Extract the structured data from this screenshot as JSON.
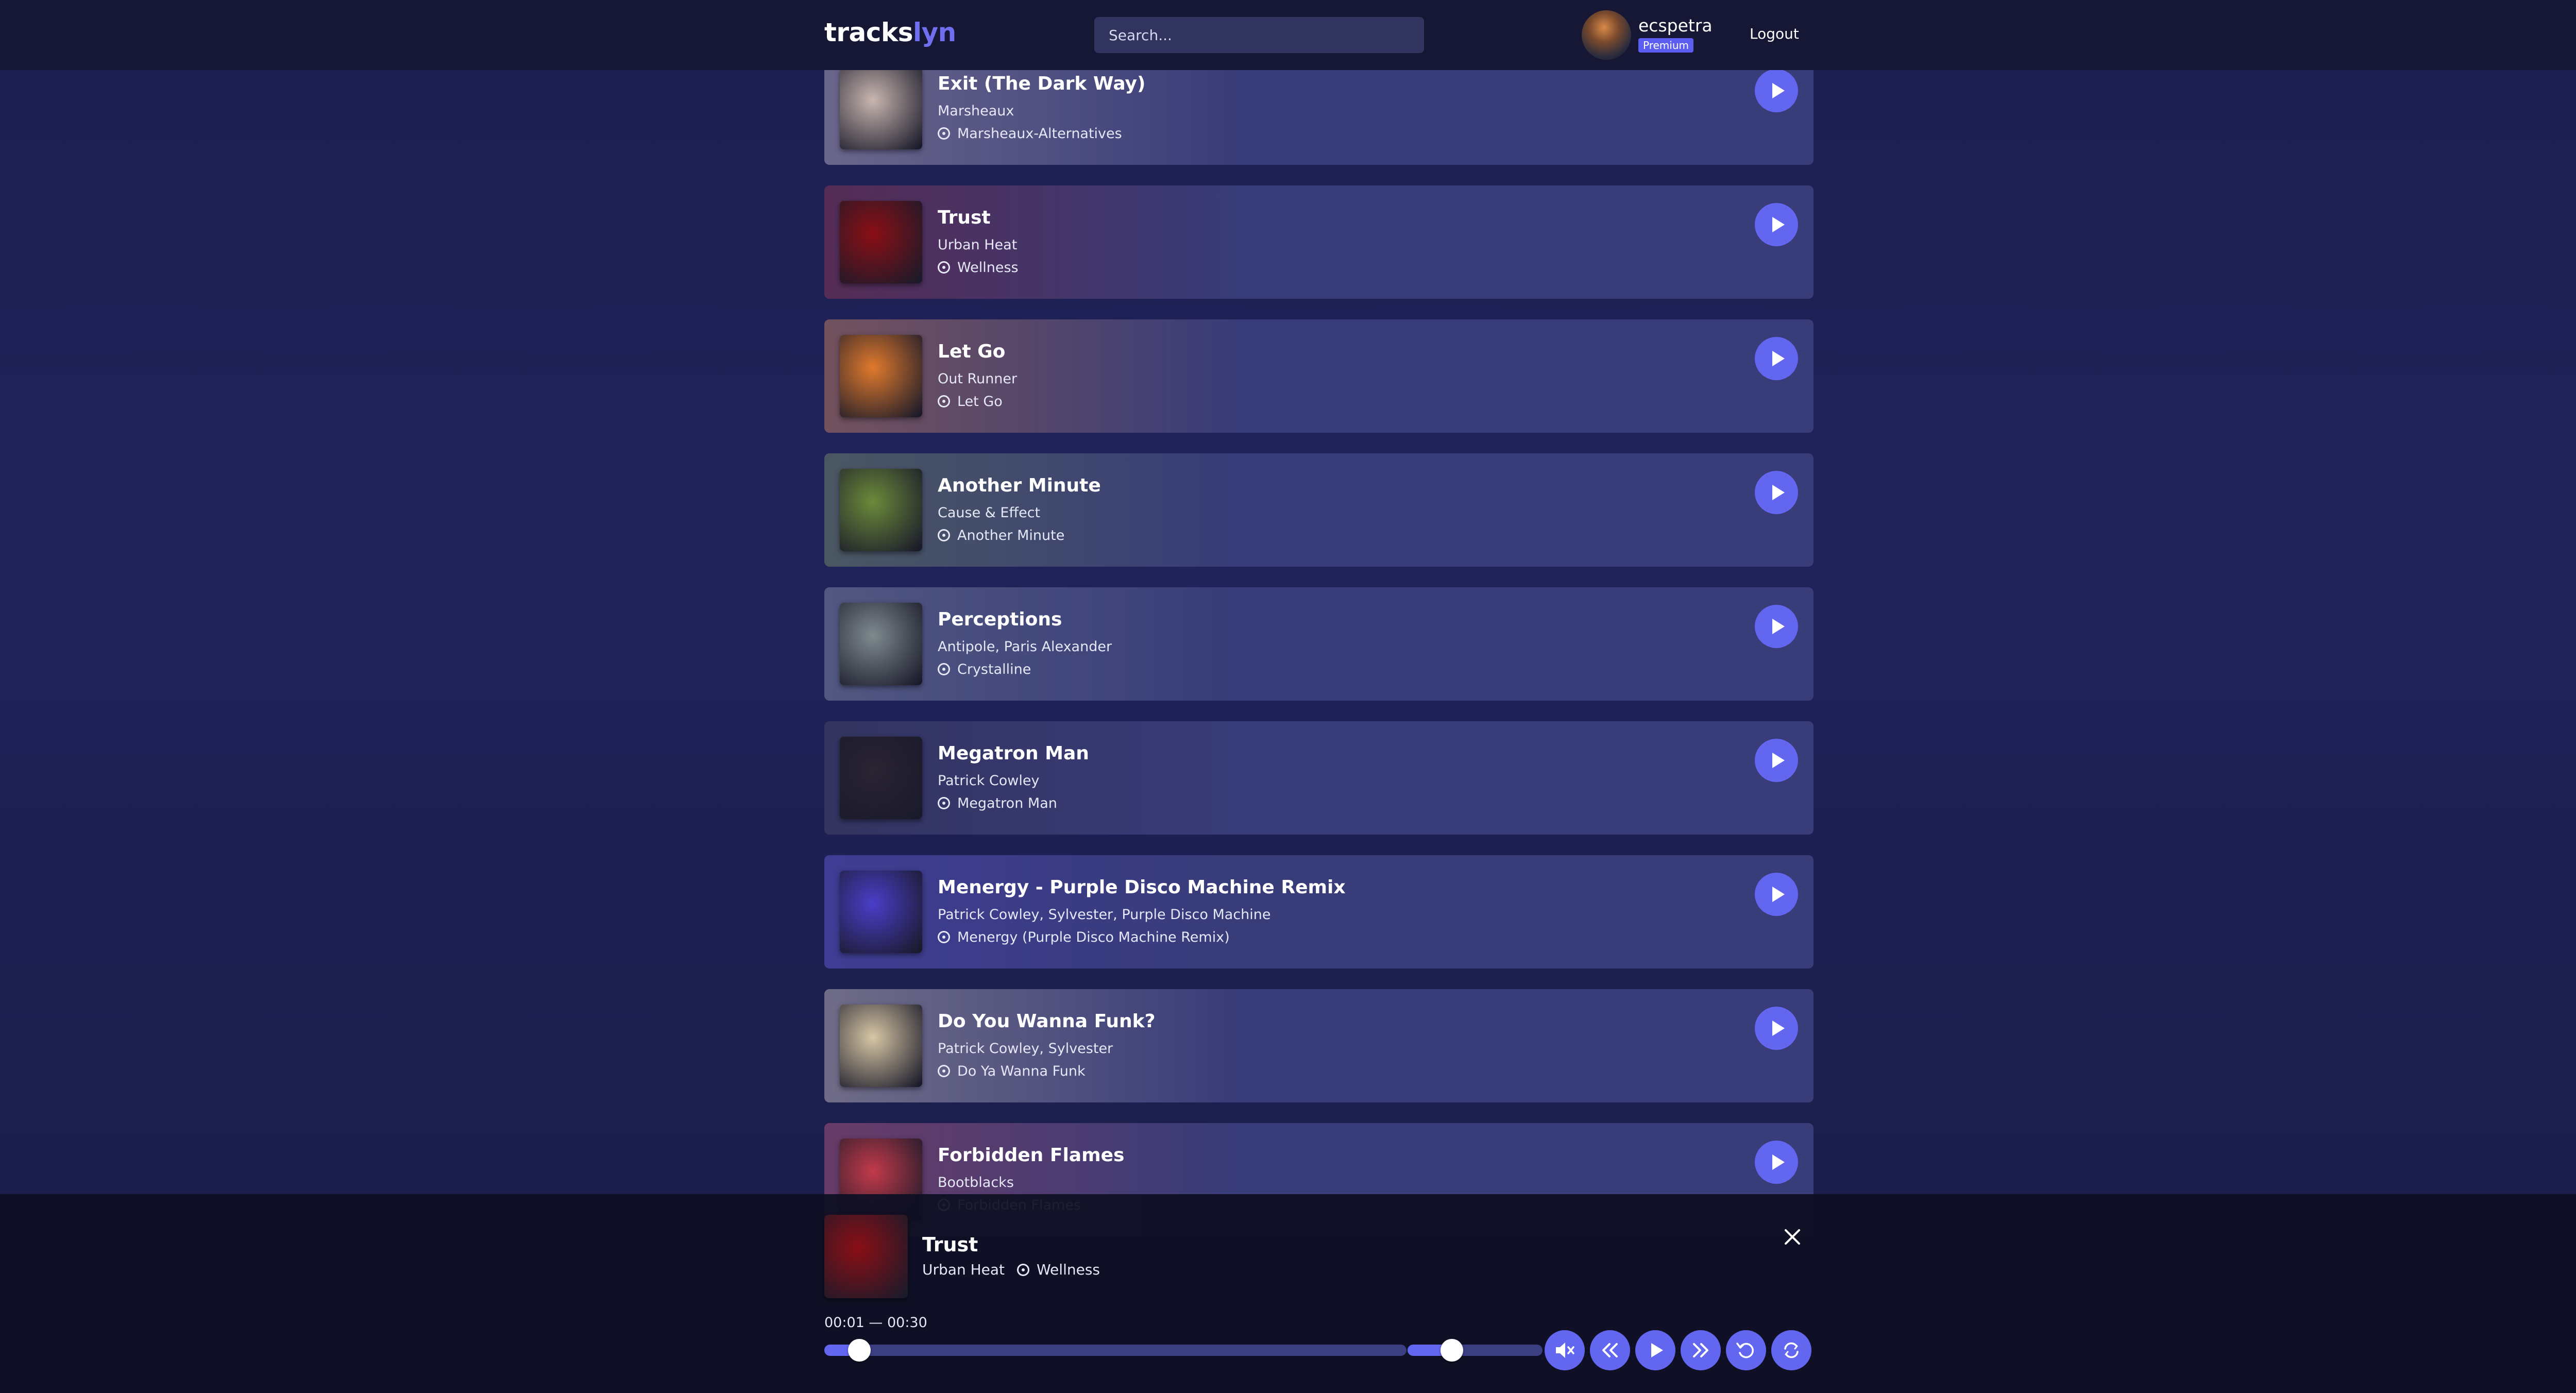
{
  "header": {
    "logo_part1": "tracks",
    "logo_part2": "lyn",
    "search_placeholder": "Search...",
    "user_name": "ecspetra",
    "badge": "Premium",
    "logout_label": "Logout"
  },
  "tracks": [
    {
      "title": "Exit (The Dark Way)",
      "artists": "Marsheaux",
      "album": "Marsheaux-Alternatives",
      "accent": "#c9b6b0"
    },
    {
      "title": "Trust",
      "artists": "Urban Heat",
      "album": "Wellness",
      "accent": "#8a0f15"
    },
    {
      "title": "Let Go",
      "artists": "Out Runner",
      "album": "Let Go",
      "accent": "#e07a2c"
    },
    {
      "title": "Another Minute",
      "artists": "Cause & Effect",
      "album": "Another Minute",
      "accent": "#6b8a3a"
    },
    {
      "title": "Perceptions",
      "artists": "Antipole, Paris Alexander",
      "album": "Crystalline",
      "accent": "#7f8a8f"
    },
    {
      "title": "Megatron Man",
      "artists": "Patrick Cowley",
      "album": "Megatron Man",
      "accent": "#2a2433"
    },
    {
      "title": "Menergy - Purple Disco Machine Remix",
      "artists": "Patrick Cowley, Sylvester, Purple Disco Machine",
      "album": "Menergy (Purple Disco Machine Remix)",
      "accent": "#4a3ec8"
    },
    {
      "title": "Do You Wanna Funk?",
      "artists": "Patrick Cowley, Sylvester",
      "album": "Do Ya Wanna Funk",
      "accent": "#d8c7a5"
    },
    {
      "title": "Forbidden Flames",
      "artists": "Bootblacks",
      "album": "Forbidden Flames",
      "accent": "#c23a4a"
    }
  ],
  "player": {
    "title": "Trust",
    "artist": "Urban Heat",
    "album": "Wellness",
    "time": "00:01 — 00:30",
    "progress": 0.033,
    "volume": 0.33,
    "cover_accent": "#8a0f15"
  },
  "colors": {
    "accent": "#6367f0",
    "card": "#383c78",
    "header": "#161735"
  },
  "icons": {
    "play": "play-icon",
    "mute": "volume-mute-icon",
    "prev": "skip-back-icon",
    "next": "skip-forward-icon",
    "replay": "replay-icon",
    "repeat": "repeat-icon",
    "close": "close-icon",
    "album": "album-icon"
  }
}
